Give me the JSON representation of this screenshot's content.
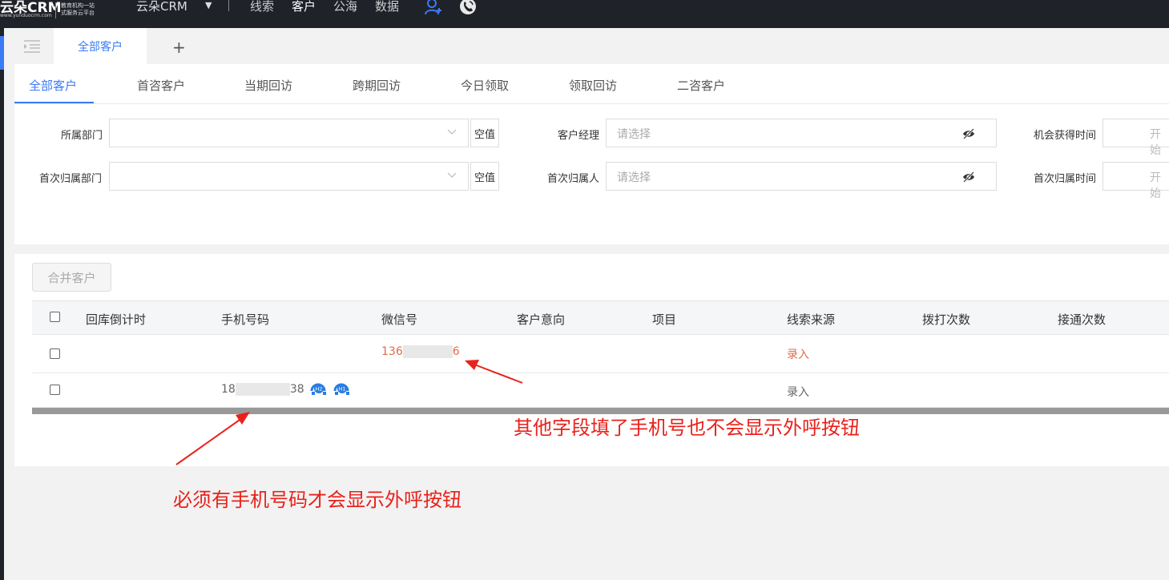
{
  "topbar": {
    "logo_main": "云朵CRM",
    "logo_url": "www.yunduocrm.com",
    "logo_sub_1": "教育机构一站",
    "logo_sub_2": "式服务云平台",
    "brand": "云朵CRM",
    "nav": [
      {
        "label": "线索",
        "active": false
      },
      {
        "label": "客户",
        "active": true
      },
      {
        "label": "公海",
        "active": false
      },
      {
        "label": "数据",
        "active": false
      }
    ]
  },
  "page_tabs": {
    "active_label": "全部客户",
    "add_label": "+"
  },
  "sub_tabs": [
    "全部客户",
    "首咨客户",
    "当期回访",
    "跨期回访",
    "今日领取",
    "领取回访",
    "二咨客户"
  ],
  "filters": {
    "dept_label": "所属部门",
    "first_dept_label": "首次归属部门",
    "empty_button": "空值",
    "manager_label": "客户经理",
    "first_owner_label": "首次归属人",
    "select_placeholder": "请选择",
    "opportunity_time_label": "机会获得时间",
    "first_owner_time_label": "首次归属时间",
    "date_placeholder": "开始"
  },
  "toolbar": {
    "merge_label": "合并客户"
  },
  "table": {
    "columns": [
      "回库倒计时",
      "手机号码",
      "微信号",
      "客户意向",
      "项目",
      "线索来源",
      "拨打次数",
      "接通次数"
    ],
    "rows": [
      {
        "wechat_prefix": "136",
        "wechat_suffix": "6",
        "source": "录入"
      },
      {
        "phone_prefix": "18",
        "phone_suffix": "38",
        "source": "录入",
        "call_icons": [
          "H2",
          "H1"
        ]
      }
    ]
  },
  "annotations": {
    "other_fields": "其他字段填了手机号也不会显示外呼按钮",
    "must_phone": "必须有手机号码才会显示外呼按钮"
  },
  "colors": {
    "accent": "#3a7bf6",
    "topbar": "#20222a",
    "orange_text": "#e06c4a",
    "annotation_red": "#e8221b"
  }
}
